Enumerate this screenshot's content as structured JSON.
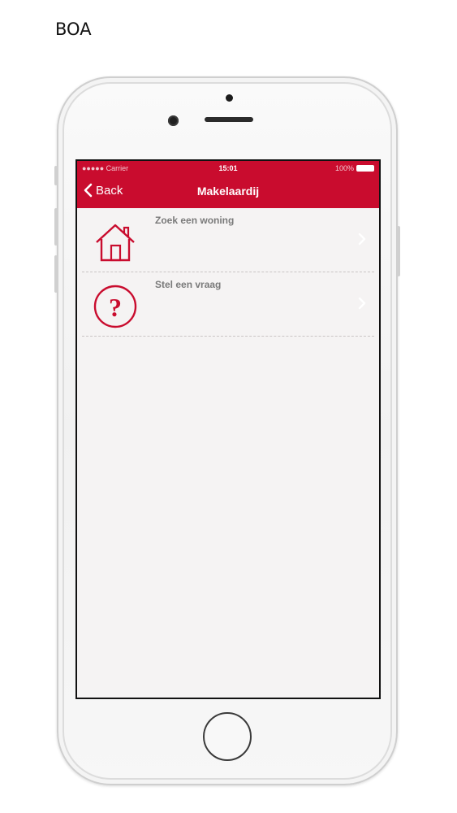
{
  "document": {
    "label": "BOA"
  },
  "status_bar": {
    "carrier": "●●●●● Carrier",
    "time": "15:01",
    "battery": "100%"
  },
  "nav": {
    "back_label": "Back",
    "title": "Makelaardij"
  },
  "menu": {
    "items": [
      {
        "label": "Zoek een woning",
        "icon": "house-icon"
      },
      {
        "label": "Stel een vraag",
        "icon": "question-icon"
      }
    ]
  },
  "colors": {
    "accent": "#c90c2e",
    "screen_bg": "#f5f3f3",
    "label_text": "#7a7a7a"
  }
}
